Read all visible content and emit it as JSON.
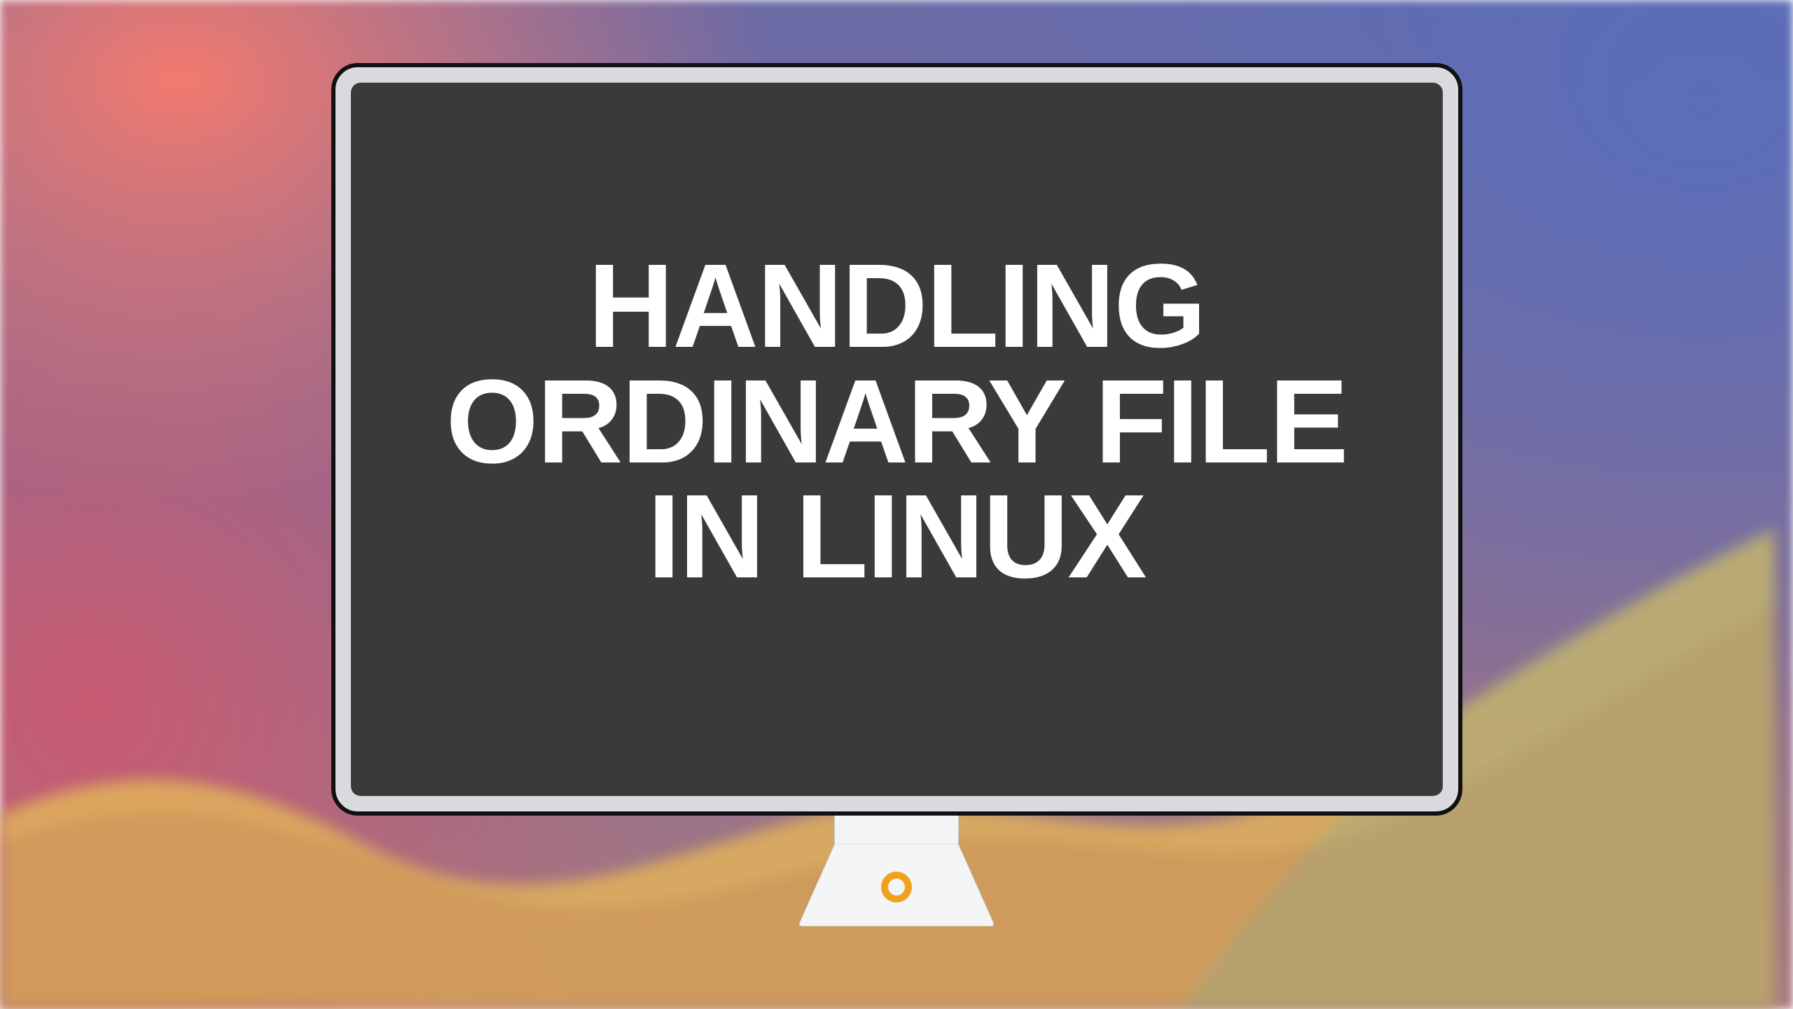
{
  "title_text": "HANDLING\nORDINARY FILE\nIN LINUX",
  "colors": {
    "screen_bg": "#3a3a3a",
    "title_color": "#ffffff",
    "power_ring": "#f0a21e"
  }
}
